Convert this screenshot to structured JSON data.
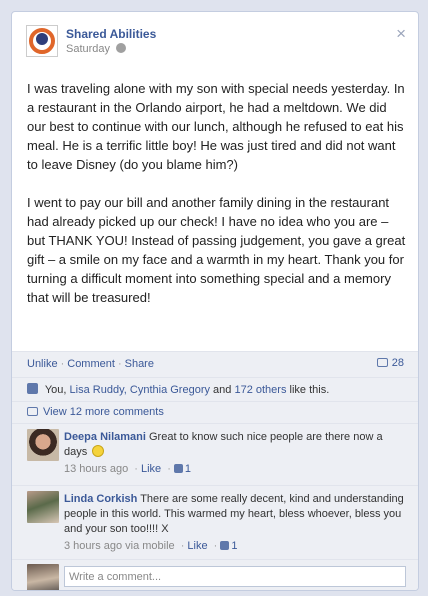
{
  "post": {
    "page_name": "Shared Abilities",
    "time": "Saturday",
    "body": "I was traveling alone with my son with special needs yesterday. In a restaurant in the Orlando airport, he had a meltdown. We did our best to continue with our lunch, although he refused to eat his meal. He is a terrific little boy! He was just tired and did not want to leave Disney (do you blame him?)\n\nI went to pay our bill and another family dining in the restaurant had already picked up our check! I have no idea who you are – but THANK YOU! Instead of passing judgement, you gave a great gift – a smile on my face and a warmth in my heart. Thank you for turning a difficult moment into something special and a memory that will be treasured!",
    "close_symbol": "×"
  },
  "actions": {
    "unlike": "Unlike",
    "comment": "Comment",
    "share": "Share",
    "comment_count": "28",
    "separator": "·"
  },
  "likes": {
    "prefix": "You,",
    "people": [
      "Lisa Ruddy,",
      "Cynthia Gregory"
    ],
    "and": "and",
    "others": "172 others",
    "suffix": "like this."
  },
  "view_more": "View 12 more comments",
  "comments": [
    {
      "name": "Deepa Nilamani",
      "text": "Great to know such nice people are there now a days",
      "time": "13 hours ago",
      "like_label": "Like",
      "like_count": "1"
    },
    {
      "name": "Linda Corkish",
      "text": "There are some really decent, kind and understanding people in this world. This warmed my heart, bless whoever, bless you and your son too!!!! X",
      "time": "3 hours ago via mobile",
      "like_label": "Like",
      "like_count": "1"
    }
  ],
  "write_comment": {
    "placeholder": "Write a comment..."
  },
  "colors": {
    "link": "#3b5998",
    "ufi_background": "#edeff4",
    "page_background": "#dfe3ee"
  }
}
